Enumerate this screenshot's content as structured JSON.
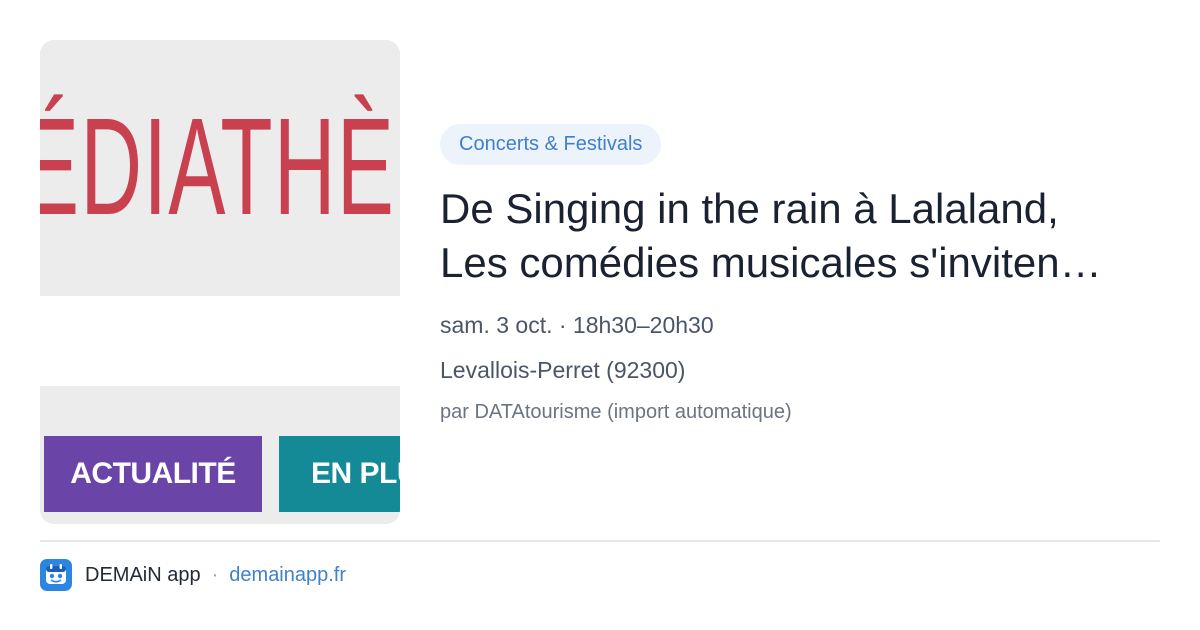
{
  "thumbnail": {
    "sign_text": "ÉDIATHÈ",
    "nav_buttons": [
      "ACTUALITÉ",
      "EN PLU"
    ],
    "colors": {
      "sign": "#c9404f",
      "actualite": "#6a45a7",
      "enplus": "#148a96"
    }
  },
  "event": {
    "category": "Concerts & Festivals",
    "title_line1": "De Singing in the rain à Lalaland,",
    "title_line2": "Les comédies musicales s'inviten…",
    "date": "sam. 3 oct. · 18h30–20h30",
    "location": "Levallois-Perret (92300)",
    "source": "par DATAtourisme (import automatique)"
  },
  "footer": {
    "app_icon": "demain-app-icon",
    "app_name": "DEMAiN app",
    "separator": "·",
    "domain": "demainapp.fr"
  },
  "colors": {
    "accent": "#3f7fd0",
    "tag_bg": "#edf3fb",
    "title": "#1a2232"
  }
}
